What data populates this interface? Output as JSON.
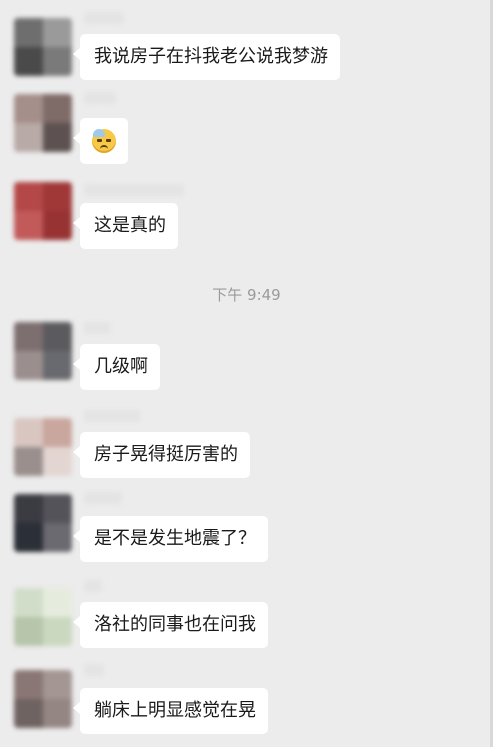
{
  "timestamp": "下午 9:49",
  "messages": [
    {
      "text": "我说房子在抖我老公说我梦游",
      "avatar_colors": [
        "#6e6e6e",
        "#9a9a9a",
        "#4a4a4a",
        "#7a7a7a"
      ]
    },
    {
      "emoji": "sweat-smile-emoji",
      "avatar_colors": [
        "#a58f8a",
        "#7f6b68",
        "#b8aaa6",
        "#5d5251"
      ]
    },
    {
      "text": "这是真的",
      "avatar_colors": [
        "#b44848",
        "#a03838",
        "#c25a5a",
        "#983333"
      ]
    },
    {
      "text": "几级啊",
      "avatar_colors": [
        "#7d6f70",
        "#5b5b5f",
        "#9b8f8e",
        "#696a6f"
      ]
    },
    {
      "text": "房子晃得挺厉害的",
      "avatar_colors": [
        "#d9c6c1",
        "#c9a69e",
        "#9a8f8d",
        "#e3d6d2"
      ]
    },
    {
      "text": "是不是发生地震了？",
      "avatar_colors": [
        "#3b3b42",
        "#55535a",
        "#2b2f37",
        "#6b6a70"
      ]
    },
    {
      "text": "洛社的同事也在问我",
      "avatar_colors": [
        "#d2ddc9",
        "#e5ecde",
        "#b7c5ab",
        "#cbd8c0"
      ]
    },
    {
      "text": "躺床上明显感觉在晃",
      "avatar_colors": [
        "#8a7775",
        "#a39693",
        "#6f6361",
        "#948683"
      ]
    }
  ]
}
